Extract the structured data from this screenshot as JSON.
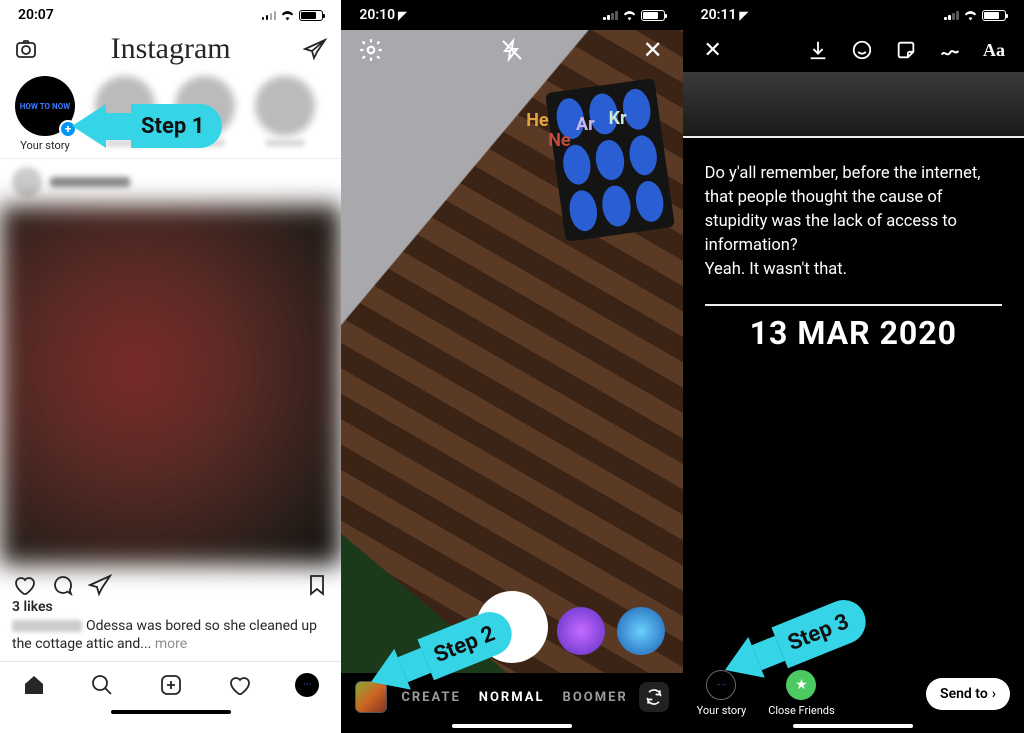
{
  "steps": {
    "s1": "Step 1",
    "s2": "Step 2",
    "s3": "Step 3"
  },
  "pane1": {
    "time": "20:07",
    "brand": "Instagram",
    "your_story_label": "Your story",
    "avatar_text": "HOW TO NOW",
    "likes": "3 likes",
    "caption": "Odessa was bored so she cleaned up the cottage attic and... ",
    "more": "more"
  },
  "pane2": {
    "time": "20:10",
    "modes": {
      "create": "CREATE",
      "normal": "NORMAL",
      "boomer": "BOOMER"
    },
    "elements": {
      "he": "He",
      "ne": "Ne",
      "ar": "Ar",
      "kr": "Kr"
    }
  },
  "pane3": {
    "time": "20:11",
    "text_label": "Aa",
    "quote": "Do y'all remember, before the internet, that people thought the cause of stupidity was the lack of access to information?\nYeah.  It wasn't that.",
    "date": "13 MAR 2020",
    "your_story": "Your story",
    "close_friends": "Close Friends",
    "send_to": "Send to"
  }
}
